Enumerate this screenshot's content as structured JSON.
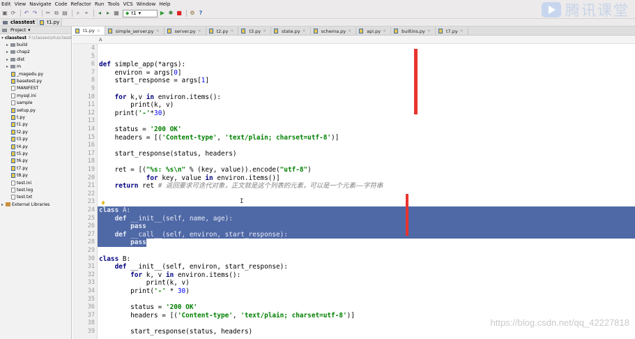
{
  "menu": [
    "Edit",
    "View",
    "Navigate",
    "Code",
    "Refactor",
    "Run",
    "Tools",
    "VCS",
    "Window",
    "Help"
  ],
  "toolbar": {
    "run_config": "t1",
    "icons": [
      "save-icon",
      "sync-icon",
      "undo-icon",
      "redo-icon",
      "cut-icon",
      "copy-icon",
      "paste-icon",
      "find-icon",
      "replace-icon",
      "back-icon",
      "forward-icon",
      "build-icon",
      "run-icon",
      "debug-icon",
      "stop-icon",
      "settings-icon",
      "help-icon"
    ]
  },
  "breadcrumb": [
    "classtest",
    "t1.py"
  ],
  "project": {
    "header": "Project",
    "root": "classtest",
    "root_path": "F:\\classes\\otu\\classt",
    "items": [
      {
        "name": "build",
        "type": "folder",
        "indent": 1,
        "arrow": "▸"
      },
      {
        "name": "chap2",
        "type": "folder",
        "indent": 1,
        "arrow": "▸"
      },
      {
        "name": "dist",
        "type": "folder",
        "indent": 1,
        "arrow": "▸"
      },
      {
        "name": "m",
        "type": "folder",
        "indent": 1,
        "arrow": "▸"
      },
      {
        "name": "_magedu.py",
        "type": "py",
        "indent": 2
      },
      {
        "name": "basetest.py",
        "type": "py",
        "indent": 2
      },
      {
        "name": "MANIFEST",
        "type": "txt",
        "indent": 2
      },
      {
        "name": "mysql.ini",
        "type": "txt",
        "indent": 2
      },
      {
        "name": "sample",
        "type": "txt",
        "indent": 2
      },
      {
        "name": "setup.py",
        "type": "py",
        "indent": 2
      },
      {
        "name": "t.py",
        "type": "py",
        "indent": 2
      },
      {
        "name": "t1.py",
        "type": "py",
        "indent": 2
      },
      {
        "name": "t2.py",
        "type": "py",
        "indent": 2
      },
      {
        "name": "t3.py",
        "type": "py",
        "indent": 2
      },
      {
        "name": "t4.py",
        "type": "py",
        "indent": 2
      },
      {
        "name": "t5.py",
        "type": "py",
        "indent": 2
      },
      {
        "name": "t6.py",
        "type": "py",
        "indent": 2
      },
      {
        "name": "t7.py",
        "type": "py",
        "indent": 2
      },
      {
        "name": "t8.py",
        "type": "py",
        "indent": 2
      },
      {
        "name": "test.ini",
        "type": "txt",
        "indent": 2
      },
      {
        "name": "test.log",
        "type": "txt",
        "indent": 2
      },
      {
        "name": "test.txt",
        "type": "txt",
        "indent": 2
      },
      {
        "name": "External Libraries",
        "type": "lib",
        "indent": 0,
        "arrow": "▸"
      }
    ]
  },
  "tabs": [
    "t1.py",
    "simple_server.py",
    "server.py",
    "t2.py",
    "t3.py",
    "state.py",
    "schema.py",
    "api.py",
    "builtins.py",
    "t7.py"
  ],
  "active_tab": "t1.py",
  "code_crumb": "A",
  "code": [
    {
      "n": "4",
      "t": ""
    },
    {
      "n": "5",
      "t": ""
    },
    {
      "n": "6",
      "t": "def simple_app(*args):"
    },
    {
      "n": "7",
      "t": "    environ = args[0]"
    },
    {
      "n": "8",
      "t": "    start_response = args[1]"
    },
    {
      "n": "9",
      "t": ""
    },
    {
      "n": "10",
      "t": "    for k,v in environ.items():"
    },
    {
      "n": "11",
      "t": "        print(k, v)"
    },
    {
      "n": "12",
      "t": "    print('-'*30)"
    },
    {
      "n": "13",
      "t": ""
    },
    {
      "n": "14",
      "t": "    status = '200 OK'"
    },
    {
      "n": "15",
      "t": "    headers = [('Content-type', 'text/plain; charset=utf-8')]"
    },
    {
      "n": "16",
      "t": ""
    },
    {
      "n": "17",
      "t": "    start_response(status, headers)"
    },
    {
      "n": "18",
      "t": ""
    },
    {
      "n": "19",
      "t": "    ret = [(\"%s: %s\\n\" % (key, value)).encode(\"utf-8\")"
    },
    {
      "n": "20",
      "t": "            for key, value in environ.items()]"
    },
    {
      "n": "21",
      "t": "    return ret # 返回要求可迭代对象，正文就是这个列表的元素，可以是一个元素——字符串"
    },
    {
      "n": "22",
      "t": ""
    },
    {
      "n": "23",
      "t": ""
    },
    {
      "n": "24",
      "t": "class A:"
    },
    {
      "n": "25",
      "t": "    def __init__(self, name, age):"
    },
    {
      "n": "26",
      "t": "        pass"
    },
    {
      "n": "27",
      "t": "    def __call__(self, environ, start_response):"
    },
    {
      "n": "28",
      "t": "        pass"
    },
    {
      "n": "29",
      "t": ""
    },
    {
      "n": "30",
      "t": "class B:"
    },
    {
      "n": "31",
      "t": "    def __init__(self, environ, start_response):"
    },
    {
      "n": "32",
      "t": "        for k, v in environ.items():"
    },
    {
      "n": "33",
      "t": "            print(k, v)"
    },
    {
      "n": "34",
      "t": "        print('-' * 30)"
    },
    {
      "n": "35",
      "t": ""
    },
    {
      "n": "36",
      "t": "        status = '200 OK'"
    },
    {
      "n": "37",
      "t": "        headers = [('Content-type', 'text/plain; charset=utf-8')]"
    },
    {
      "n": "38",
      "t": ""
    },
    {
      "n": "39",
      "t": "        start_response(status, headers)"
    }
  ],
  "selection": {
    "from_line": "24",
    "to_line": "28"
  },
  "watermark": {
    "brand": "腾讯课堂",
    "url": "https://blog.csdn.net/qq_42227818"
  },
  "colors": {
    "selection": "#4f68a6",
    "red_marker": "#e8342e",
    "keyword": "#000080",
    "string": "#008000"
  }
}
